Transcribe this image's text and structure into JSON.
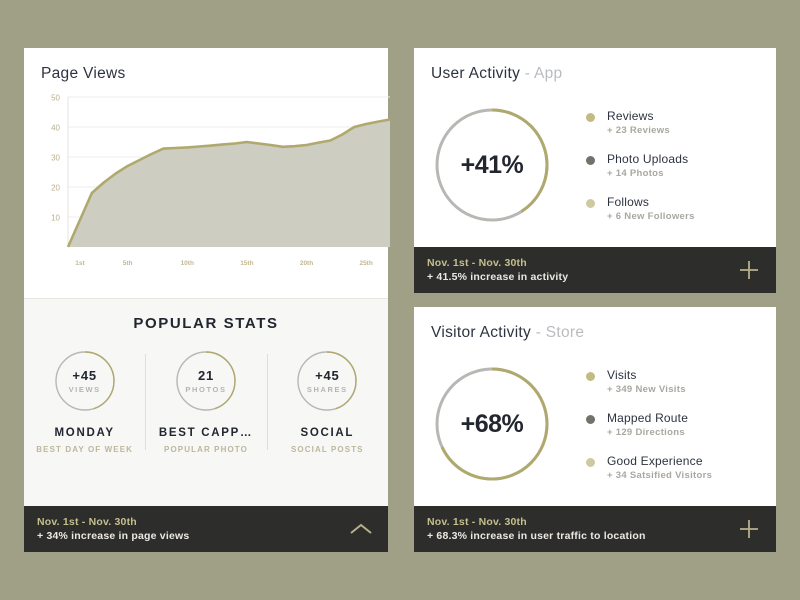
{
  "theme": {
    "background": "#a0a086",
    "card_bg": "#ffffff",
    "stats_bg": "#f7f7f6",
    "footer_bg": "#2d2d2b",
    "gold": "#b0a96e",
    "gold_light": "#c6bf8e",
    "area_fill": "#cdcdc2",
    "ring_gray": "#b7b7b3",
    "dark_dot": "#72726a",
    "title_color": "#2d3340",
    "muted_color": "#b9bcc1"
  },
  "page_views": {
    "title": "Page Views",
    "footer": {
      "range": "Nov. 1st - Nov. 30th",
      "note": "+ 34% increase in page views",
      "icon": "chevron-up-icon"
    }
  },
  "chart_data": {
    "type": "area",
    "title": "Page Views",
    "xlabel": "",
    "ylabel": "",
    "ylim": [
      0,
      50
    ],
    "grid": true,
    "legend": "none",
    "ytick_labels": [
      "10",
      "20",
      "30",
      "40",
      "50"
    ],
    "yticks": [
      10,
      20,
      30,
      40,
      50
    ],
    "xtick_labels": [
      "1st",
      "5th",
      "10th",
      "15th",
      "20th",
      "25th"
    ],
    "xticks": [
      1,
      5,
      10,
      15,
      20,
      25
    ],
    "x": [
      0,
      1,
      2,
      3,
      4,
      5,
      6,
      7,
      8,
      9,
      10,
      11,
      12,
      13,
      14,
      15,
      16,
      17,
      18,
      19,
      20,
      21,
      22,
      23,
      24,
      25,
      26,
      27
    ],
    "values": [
      0,
      9,
      18,
      21.5,
      24.5,
      27,
      29,
      31,
      32.8,
      33,
      33.2,
      33.5,
      33.8,
      34.2,
      34.5,
      35,
      34.5,
      34,
      33.4,
      33.6,
      34,
      34.8,
      35.5,
      37.5,
      40,
      41,
      41.8,
      42.5
    ]
  },
  "popular_stats": {
    "heading": "POPULAR STATS",
    "items": [
      {
        "value": "+45",
        "unit": "VIEWS",
        "name": "MONDAY",
        "sub": "BEST DAY OF WEEK",
        "arc_pct": 45
      },
      {
        "value": "21",
        "unit": "PHOTOS",
        "name": "BEST CAPP…",
        "sub": "POPULAR PHOTO",
        "arc_pct": 45
      },
      {
        "value": "+45",
        "unit": "SHARES",
        "name": "SOCIAL",
        "sub": "SOCIAL POSTS",
        "arc_pct": 45
      }
    ]
  },
  "user_activity": {
    "title": "User Activity",
    "title_suffix": " - App",
    "donut_value": "+41%",
    "donut_pct": 41,
    "legend": [
      {
        "label": "Reviews",
        "sub": "+ 23 Reviews",
        "color": "#c3bb84"
      },
      {
        "label": "Photo Uploads",
        "sub": "+ 14 Photos",
        "color": "#72726a"
      },
      {
        "label": "Follows",
        "sub": "+ 6 New Followers",
        "color": "#cfc9a1"
      }
    ],
    "footer": {
      "range": "Nov. 1st - Nov. 30th",
      "note": "+ 41.5% increase in activity",
      "icon": "plus-icon"
    }
  },
  "visitor_activity": {
    "title": "Visitor Activity",
    "title_suffix": " - Store",
    "donut_value": "+68%",
    "donut_pct": 68,
    "legend": [
      {
        "label": "Visits",
        "sub": "+ 349 New Visits",
        "color": "#c3bb84"
      },
      {
        "label": "Mapped Route",
        "sub": "+ 129 Directions",
        "color": "#72726a"
      },
      {
        "label": "Good Experience",
        "sub": "+ 34 Satsified Visitors",
        "color": "#cfc9a1"
      }
    ],
    "footer": {
      "range": "Nov. 1st - Nov. 30th",
      "note": "+ 68.3% increase in user traffic to location",
      "icon": "plus-icon"
    }
  }
}
